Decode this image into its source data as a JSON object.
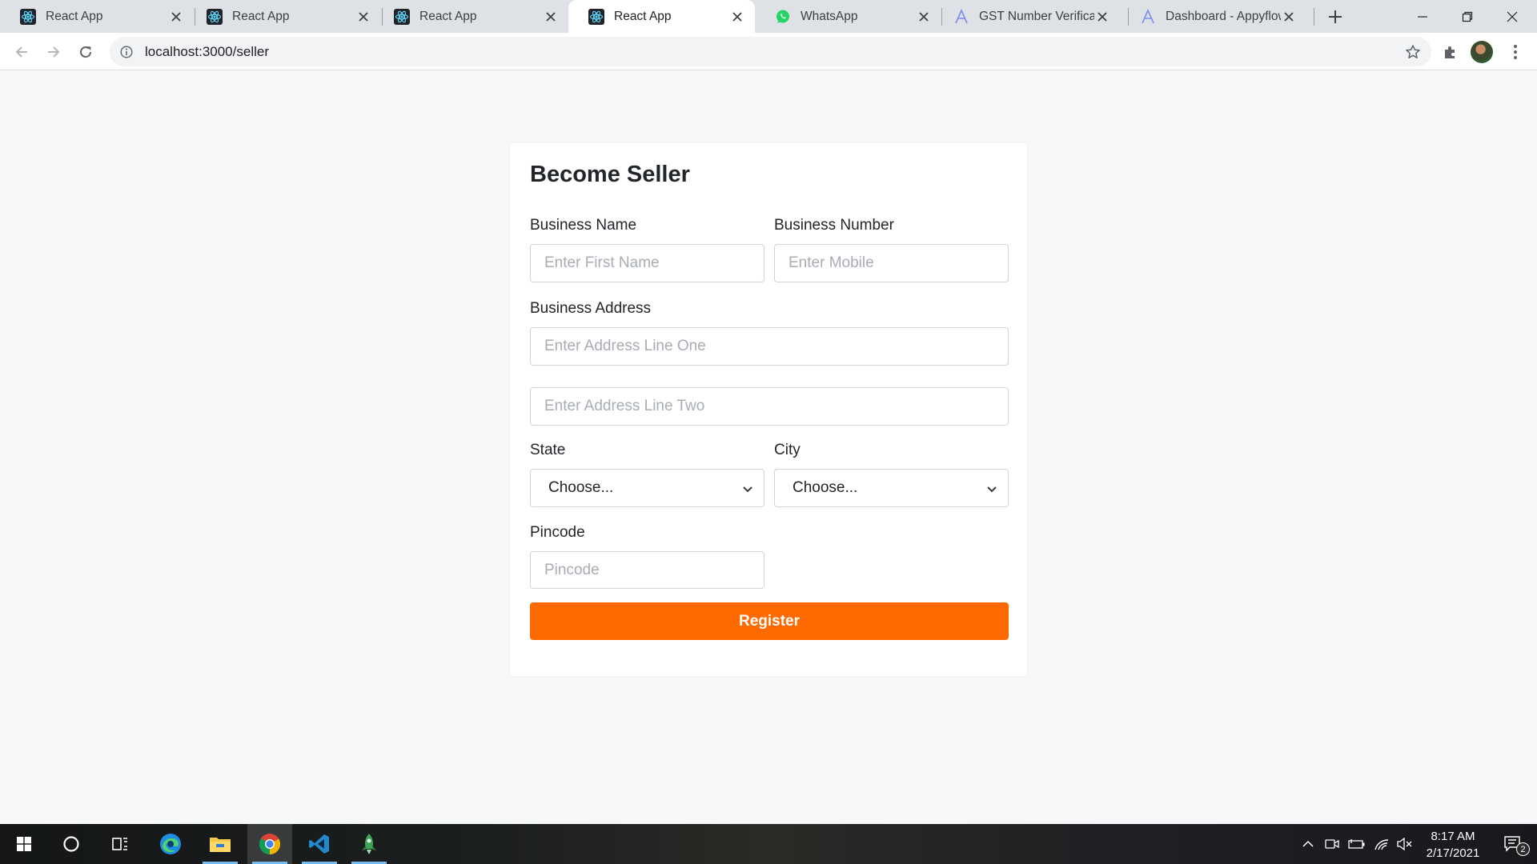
{
  "browser": {
    "tabs": [
      {
        "title": "React App",
        "icon": "react-icon",
        "active": false
      },
      {
        "title": "React App",
        "icon": "react-icon",
        "active": false
      },
      {
        "title": "React App",
        "icon": "react-icon",
        "active": false
      },
      {
        "title": "React App",
        "icon": "react-icon",
        "active": true
      },
      {
        "title": "WhatsApp",
        "icon": "whatsapp-icon",
        "active": false
      },
      {
        "title": "GST Number Verificatio",
        "icon": "appyflow-icon",
        "active": false
      },
      {
        "title": "Dashboard - Appyflow",
        "icon": "appyflow-icon",
        "active": false
      }
    ],
    "url": "localhost:3000/seller"
  },
  "form": {
    "title": "Become Seller",
    "business_name": {
      "label": "Business Name",
      "placeholder": "Enter First Name",
      "value": ""
    },
    "business_number": {
      "label": "Business Number",
      "placeholder": "Enter Mobile",
      "value": ""
    },
    "address": {
      "label": "Business Address",
      "line_one_placeholder": "Enter Address Line One",
      "line_two_placeholder": "Enter Address Line Two"
    },
    "state": {
      "label": "State",
      "selected": "Choose..."
    },
    "city": {
      "label": "City",
      "selected": "Choose..."
    },
    "pincode": {
      "label": "Pincode",
      "placeholder": "Pincode",
      "value": ""
    },
    "register_label": "Register"
  },
  "colors": {
    "accent": "#ff6a00",
    "page_background": "#f7f8fa",
    "input_border": "#ced4da"
  },
  "taskbar": {
    "apps": [
      "windows-start-icon",
      "cortana-icon",
      "task-view-icon",
      "edge-icon",
      "file-explorer-icon",
      "chrome-icon",
      "vscode-icon",
      "rocket-app-icon"
    ],
    "time": "8:17 AM",
    "date": "2/17/2021",
    "notification_count": "2"
  }
}
